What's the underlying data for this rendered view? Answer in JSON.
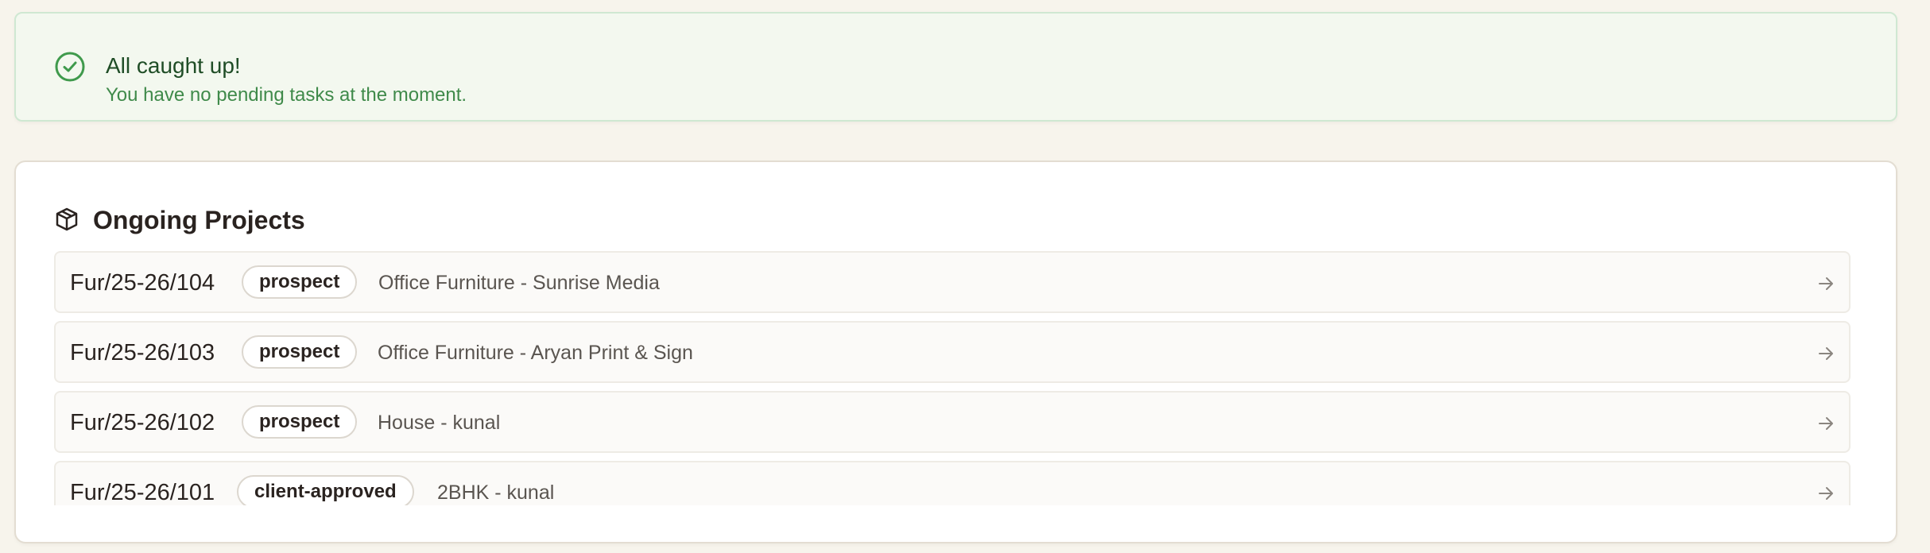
{
  "alert": {
    "title": "All caught up!",
    "subtitle": "You have no pending tasks at the moment.",
    "icon": "check-circle-icon",
    "colors": {
      "background": "#f3f8ef",
      "border": "#cfe8d2",
      "title": "#1f4d26",
      "text": "#3f8a4a"
    }
  },
  "projects": {
    "title": "Ongoing Projects",
    "icon": "package-icon",
    "items": [
      {
        "code": "Fur/25-26/104",
        "status": "prospect",
        "name": "Office Furniture - Sunrise Media"
      },
      {
        "code": "Fur/25-26/103",
        "status": "prospect",
        "name": "Office Furniture - Aryan Print & Sign"
      },
      {
        "code": "Fur/25-26/102",
        "status": "prospect",
        "name": "House - kunal"
      },
      {
        "code": "Fur/25-26/101",
        "status": "client-approved",
        "name": "2BHK - kunal"
      }
    ]
  }
}
